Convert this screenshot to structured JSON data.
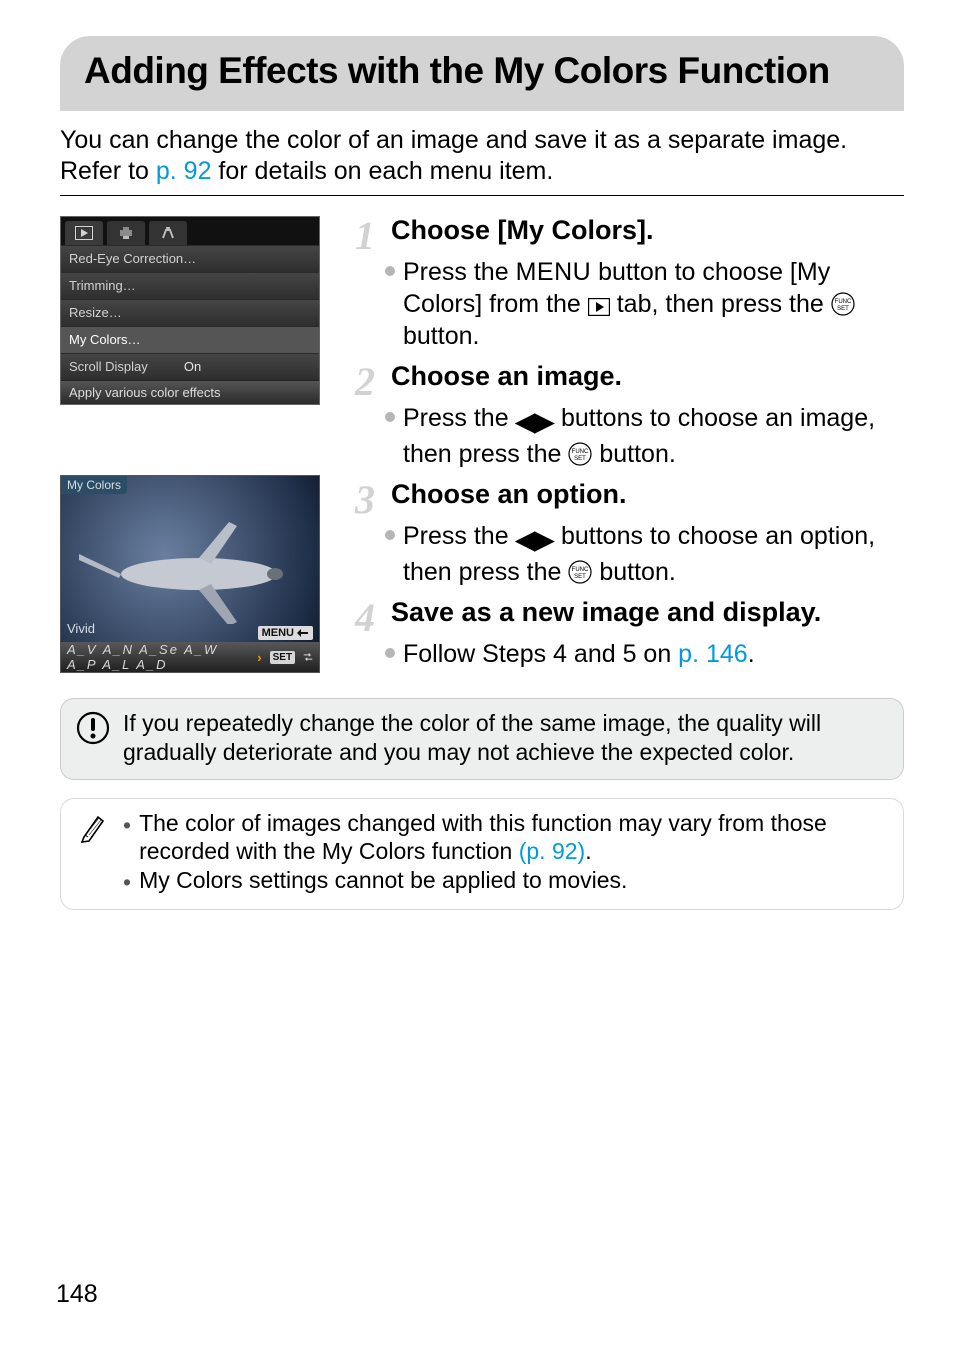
{
  "title": "Adding Effects with the My Colors Function",
  "intro_part1": "You can change the color of an image and save it as a separate image. Refer to ",
  "intro_link": "p. 92",
  "intro_part2": " for details on each menu item.",
  "screenshot1": {
    "rows": {
      "red_eye": "Red-Eye Correction…",
      "trimming": "Trimming…",
      "resize": "Resize…",
      "my_colors": "My Colors…",
      "scroll_display_label": "Scroll Display",
      "scroll_display_value": "On"
    },
    "footer": "Apply various color effects"
  },
  "screenshot2": {
    "badge": "My Colors",
    "vivid": "Vivid",
    "menu_label": "MENU",
    "footer_icons": "A_V A_N A_Se A_W A_P A_L A_D",
    "set": "SET"
  },
  "steps": {
    "s1": {
      "num": "1",
      "title": "Choose [My Colors].",
      "body_a": "Press the ",
      "menu_label": "MENU",
      "body_b": " button to choose [My Colors] from the ",
      "body_c": " tab, then press the ",
      "body_d": " button."
    },
    "s2": {
      "num": "2",
      "title": "Choose an image.",
      "body_a": "Press the ",
      "body_b": " buttons to choose an image, then press the ",
      "body_c": " button."
    },
    "s3": {
      "num": "3",
      "title": "Choose an option.",
      "body_a": "Press the ",
      "body_b": " buttons to choose an option, then press the ",
      "body_c": " button."
    },
    "s4": {
      "num": "4",
      "title": "Save as a new image and display.",
      "body_a": "Follow Steps 4 and 5 on ",
      "link": "p. 146",
      "body_b": "."
    }
  },
  "caution": "If you repeatedly change the color of the same image, the quality will gradually deteriorate and you may not achieve the expected color.",
  "tips": {
    "t1a": "The color of images changed with this function may vary from those recorded with the My Colors function ",
    "t1link": "(p. 92)",
    "t1b": ".",
    "t2": "My Colors settings cannot be applied to movies."
  },
  "page_number": "148"
}
